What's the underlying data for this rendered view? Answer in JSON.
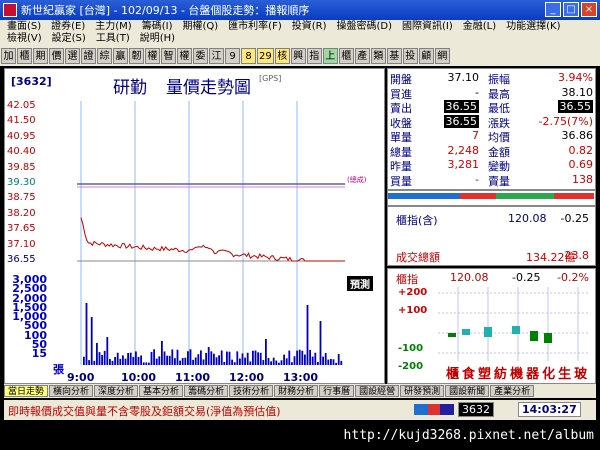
{
  "window": {
    "title": "新世紀贏家 [台灣] - 102/09/13 - 台盤個股走勢：播報順序",
    "controls": [
      "minimize-icon",
      "maximize-icon",
      "close-icon"
    ]
  },
  "menu": {
    "row1": [
      "畫面(S)",
      "證券(E)",
      "主力(M)",
      "籌碼(I)",
      "期權(Q)",
      "匯市利率(F)",
      "投資(R)",
      "操盤密碼(D)",
      "國際資訊(I)",
      "金融(L)",
      "功能選擇(K)"
    ],
    "row2": [
      "檢視(V)",
      "設定(S)",
      "工具(T)",
      "說明(H)"
    ]
  },
  "quickbar": [
    "加",
    "櫃",
    "期",
    "價",
    "選",
    "證",
    "綜",
    "贏",
    "韌",
    "權",
    "智",
    "權",
    "委",
    "江",
    "9",
    "8",
    "29",
    "核",
    "興",
    "指",
    "上",
    "櫃",
    "產",
    "類",
    "基",
    "投",
    "顧",
    "網"
  ],
  "chart": {
    "stock_code": "[3632]",
    "stock_name": "研勤",
    "title": "量價走勢圖",
    "gps_tag": "[GPS]",
    "price_ticks": [
      "42.05",
      "41.50",
      "40.95",
      "40.40",
      "39.85",
      "39.30",
      "38.75",
      "38.20",
      "37.65",
      "37.10",
      "36.55"
    ],
    "volume_ticks": [
      "3,000",
      "2,500",
      "2,000",
      "1,500",
      "1,000",
      "500",
      "100",
      "50",
      "15"
    ],
    "volume_unit": "張",
    "time_ticks": [
      "9:00",
      "10:00",
      "11:00",
      "12:00",
      "13:00"
    ],
    "ref_note": "(總成)",
    "predict_label": "預測"
  },
  "chart_data": {
    "type": "line",
    "title": "量價走勢圖",
    "xlabel": "",
    "ylabel": "",
    "x": [
      "9:00",
      "10:00",
      "11:00",
      "12:00",
      "13:00"
    ],
    "ylim": [
      36.55,
      42.05
    ],
    "series": [
      {
        "name": "",
        "color": "#c00000",
        "values": [
          37.9,
          37.1,
          37.0,
          36.8,
          36.6,
          36.55
        ]
      }
    ],
    "reference_lines": [
      39.3
    ],
    "volume_ylim": [
      0,
      3000
    ]
  },
  "info": {
    "rows": [
      {
        "k1": "開盤",
        "v1": "37.10",
        "k2": "振幅",
        "v2": "3.94%"
      },
      {
        "k1": "買進",
        "v1": "-",
        "k2": "最高",
        "v2": "38.10"
      },
      {
        "k1": "賣出",
        "v1": "36.55",
        "k2": "最低",
        "v2": "36.55"
      },
      {
        "k1": "收盤",
        "v1": "36.55",
        "k2": "漲跌",
        "v2": "-2.75(7%)"
      },
      {
        "k1": "單量",
        "v1": "7",
        "k2": "均價",
        "v2": "36.86"
      },
      {
        "k1": "總量",
        "v1": "2,248",
        "k2": "金額",
        "v2": "0.82"
      },
      {
        "k1": "昨量",
        "v1": "3,281",
        "k2": "變動",
        "v2": "0.69"
      },
      {
        "k1": "買量",
        "v1": "-",
        "k2": "賣量",
        "v2": "138"
      }
    ]
  },
  "index": {
    "label": "櫃指(含)",
    "value": "120.08",
    "change": "-0.25",
    "label2": "成交總額",
    "value2": "134.22億",
    "change2": "23.8"
  },
  "sector": {
    "label": "櫃指",
    "value": "120.08",
    "change": "-0.25",
    "pct": "-0.2%",
    "scale": [
      "+200",
      "+100",
      "-100",
      "-200"
    ],
    "names": [
      "櫃",
      "食",
      "塑",
      "紡",
      "機",
      "器",
      "化",
      "生",
      "玻"
    ]
  },
  "tabs": [
    "當日走勢",
    "橫向分析",
    "深度分析",
    "基本分析",
    "籌碼分析",
    "技術分析",
    "財務分析",
    "行事曆",
    "國設經營",
    "研發預測",
    "國設新聞",
    "產業分析"
  ],
  "status": {
    "message": "即時報價成交值與量不含零股及鉅額交易(淨值為預估值)",
    "code": "3632",
    "time": "14:03:27"
  },
  "watermark_url": "http://kujd3268.pixnet.net/album",
  "colors": {
    "price_line": "#c00000",
    "reference": "#808080",
    "volume": "#0000c0",
    "titlebar": "#0a3cc0"
  }
}
